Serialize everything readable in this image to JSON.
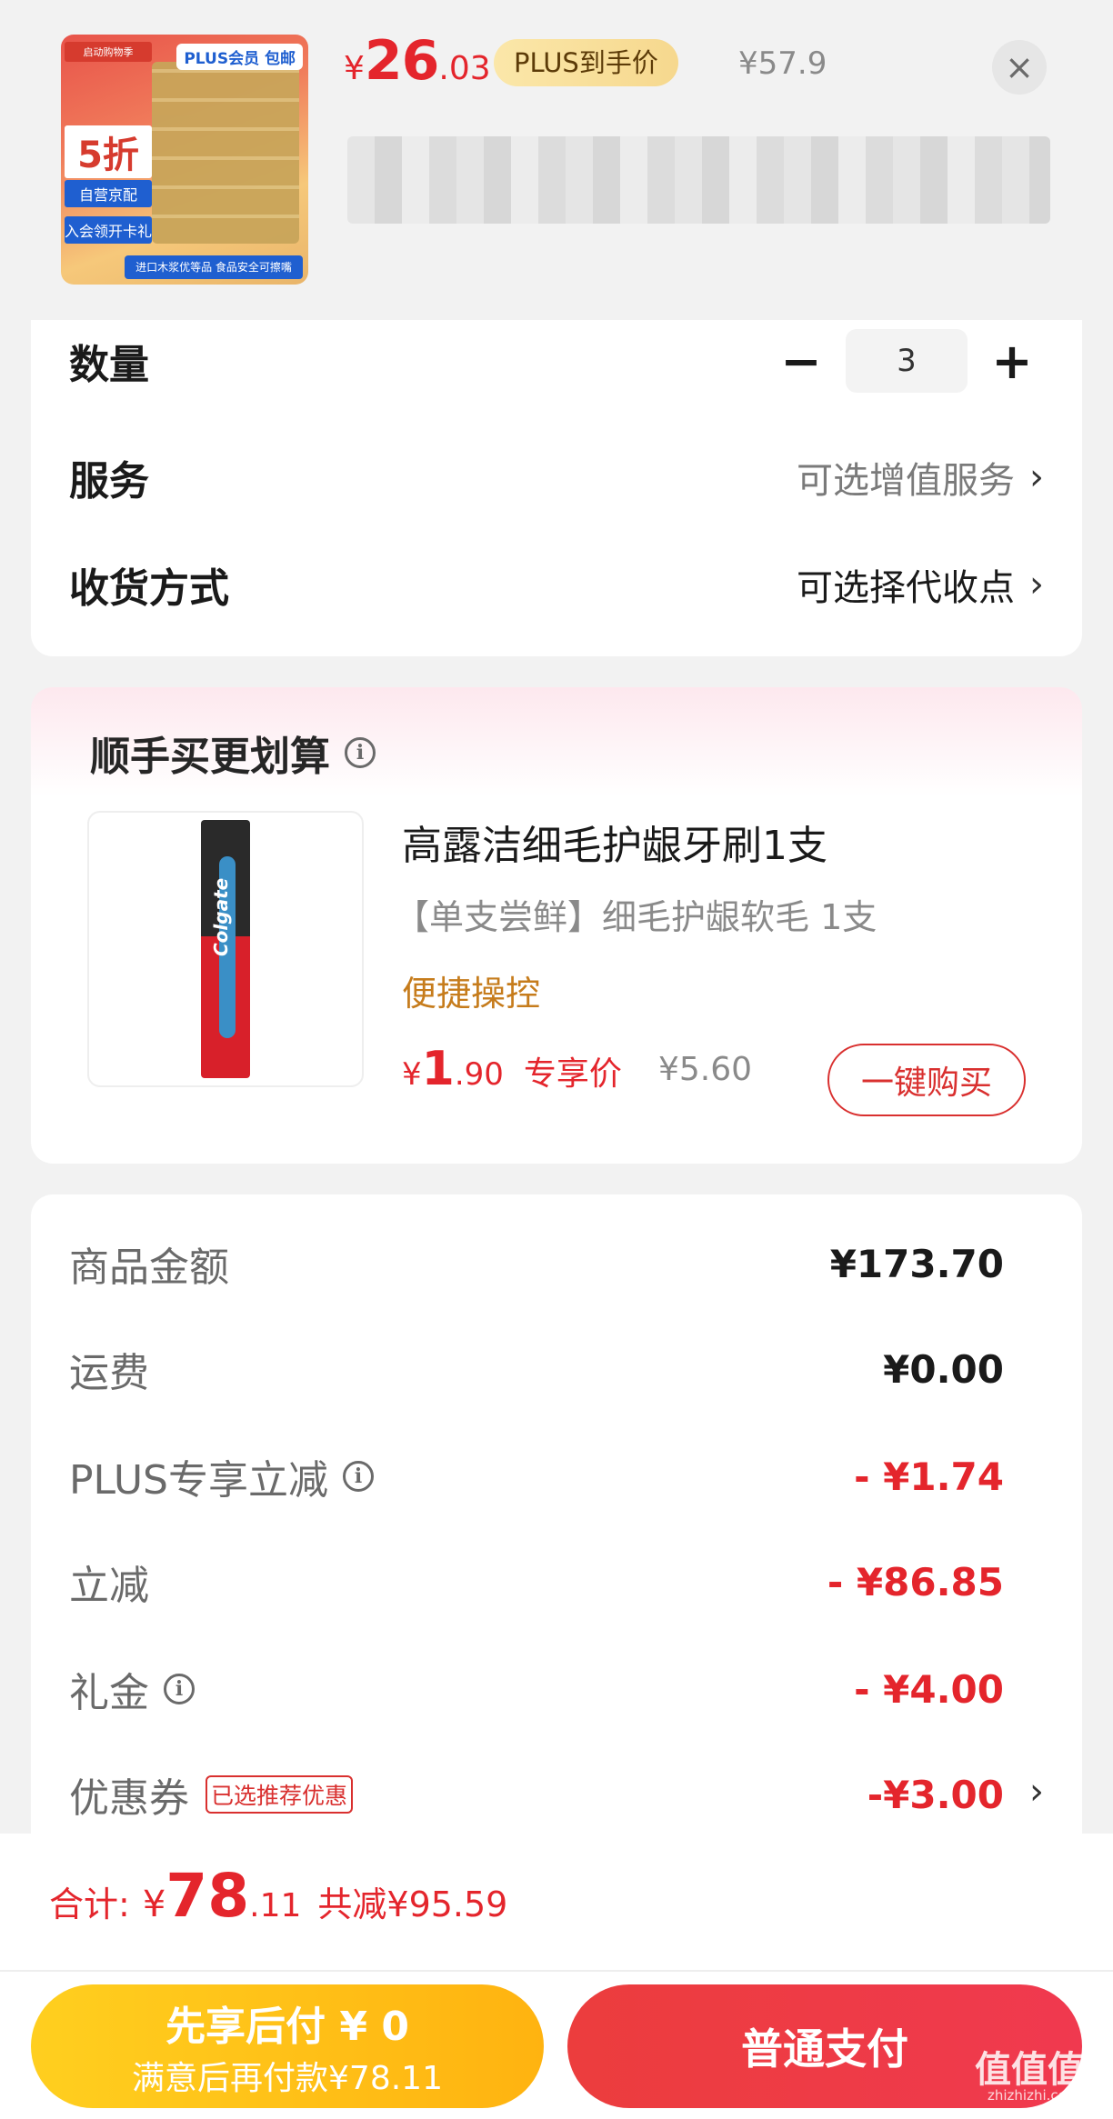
{
  "header": {
    "thumbnail": {
      "brand": "PLUS会员 包邮",
      "tag_top": "启动购物季",
      "discount": "5折",
      "tag_jd": "自营京配",
      "tag_member": "入会领开卡礼",
      "footer": "进口木浆优等品 食品安全可擦嘴"
    },
    "price_yen": "¥",
    "price_int": "26",
    "price_dec": ".03",
    "plus_badge": "PLUS到手价",
    "original_price": "¥57.9",
    "close_icon": "×"
  },
  "options": {
    "quantity_label": "数量",
    "quantity_minus": "−",
    "quantity_value": "3",
    "quantity_plus": "+",
    "service_label": "服务",
    "service_value": "可选增值服务",
    "delivery_label": "收货方式",
    "delivery_value": "可选择代收点"
  },
  "recommend": {
    "heading": "顺手买更划算",
    "info_icon": "i",
    "product_name": "高露洁细毛护龈牙刷1支",
    "product_spec": "【单支尝鲜】细毛护龈软毛 1支",
    "product_feature": "便捷操控",
    "price_yen": "¥",
    "price_int": "1",
    "price_dec": ".90",
    "price_tag": "专享价",
    "original_price": "¥5.60",
    "buy_button": "一键购买",
    "image_brand": "Colgate"
  },
  "summary": {
    "rows": [
      {
        "label": "商品金额",
        "value": "¥173.70"
      },
      {
        "label": "运费",
        "value": "¥0.00"
      },
      {
        "label": "PLUS专享立减",
        "value": "- ¥1.74"
      },
      {
        "label": "立减",
        "value": "- ¥86.85"
      },
      {
        "label": "礼金",
        "value": "- ¥4.00"
      },
      {
        "label": "优惠券",
        "value": "-¥3.00",
        "tag": "已选推荐优惠"
      }
    ]
  },
  "bottom": {
    "total_label": "合计:",
    "total_yen": "¥",
    "total_int": "78",
    "total_dec": ".11",
    "total_saved": "共减¥95.59",
    "pay_later_title": "先享后付 ¥ 0",
    "pay_later_sub": "满意后再付款¥78.11",
    "pay_normal": "普通支付"
  },
  "watermark": {
    "main": "值值值",
    "sub": "zhizhizhi.com"
  },
  "colors": {
    "accent_red": "#e4252c",
    "plus_gold": "#f6d88e",
    "pay_later_yellow": "#ffb310"
  },
  "icons": [
    "close-icon",
    "info-icon",
    "chevron-right-icon",
    "minus-icon",
    "plus-icon"
  ]
}
